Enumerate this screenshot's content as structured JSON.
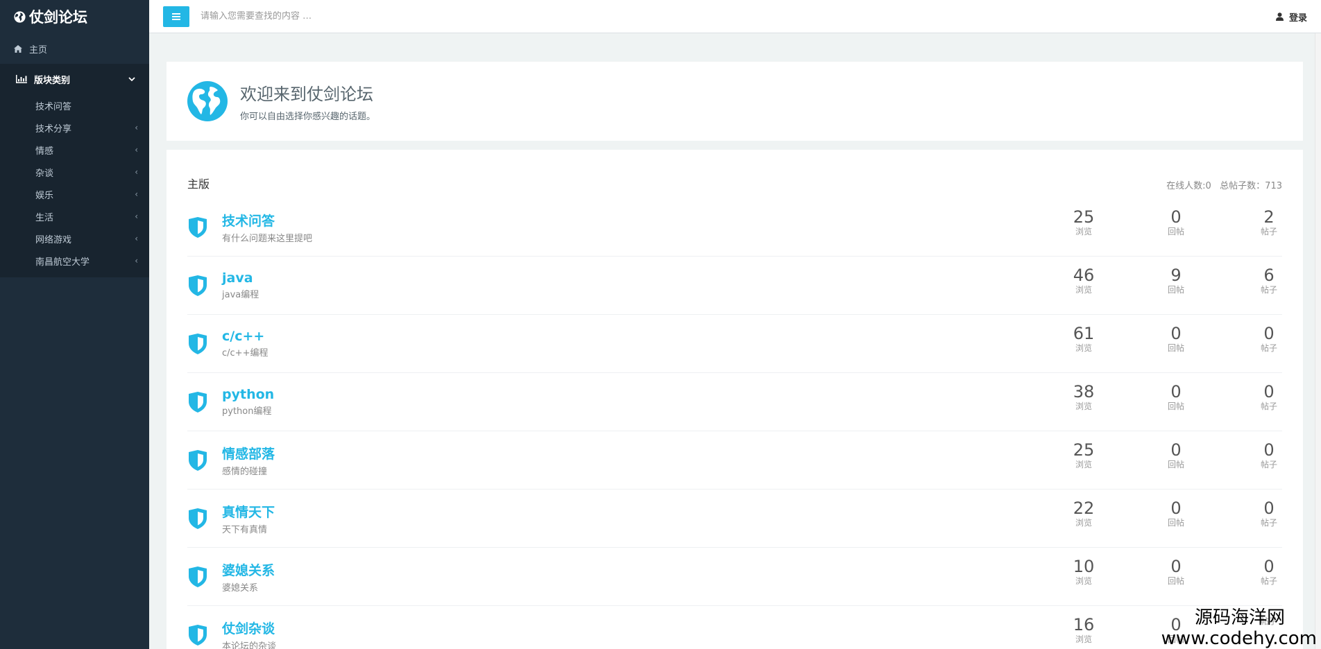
{
  "sidebar": {
    "brand": "仗剑论坛",
    "home": "主页",
    "group": {
      "label": "版块类别"
    },
    "items": [
      {
        "label": "技术问答",
        "chevron": ""
      },
      {
        "label": "技术分享",
        "chevron": "‹"
      },
      {
        "label": "情感",
        "chevron": "‹"
      },
      {
        "label": "杂谈",
        "chevron": "‹"
      },
      {
        "label": "娱乐",
        "chevron": "‹"
      },
      {
        "label": "生活",
        "chevron": "‹"
      },
      {
        "label": "网络游戏",
        "chevron": "‹"
      },
      {
        "label": "南昌航空大学",
        "chevron": "‹"
      }
    ]
  },
  "topbar": {
    "search_placeholder": "请输入您需要查找的内容 …",
    "login": "登录"
  },
  "welcome": {
    "title": "欢迎来到仗剑论坛",
    "subtitle": "你可以自由选择你感兴趣的话题。"
  },
  "board": {
    "title": "主版",
    "online": "在线人数:0",
    "total_posts": "总帖子数：713",
    "stat_labels": {
      "views": "浏览",
      "replies": "回帖",
      "posts": "帖子"
    },
    "forums": [
      {
        "name": "技术问答",
        "desc": "有什么问题来这里提吧",
        "views": "25",
        "replies": "0",
        "posts": "2"
      },
      {
        "name": "java",
        "desc": "java编程",
        "views": "46",
        "replies": "9",
        "posts": "6"
      },
      {
        "name": "c/c++",
        "desc": "c/c++编程",
        "views": "61",
        "replies": "0",
        "posts": "0"
      },
      {
        "name": "python",
        "desc": "python编程",
        "views": "38",
        "replies": "0",
        "posts": "0"
      },
      {
        "name": "情感部落",
        "desc": "感情的碰撞",
        "views": "25",
        "replies": "0",
        "posts": "0"
      },
      {
        "name": "真情天下",
        "desc": "天下有真情",
        "views": "22",
        "replies": "0",
        "posts": "0"
      },
      {
        "name": "婆媳关系",
        "desc": "婆媳关系",
        "views": "10",
        "replies": "0",
        "posts": "0"
      },
      {
        "name": "仗剑杂谈",
        "desc": "本论坛的杂谈",
        "views": "16",
        "replies": "0",
        "posts": ""
      }
    ]
  },
  "watermark": {
    "line1": "源码海洋网",
    "line2": "www.codehy.com"
  },
  "colors": {
    "accent": "#23b7e5",
    "sidebar_bg": "#1e2d3b",
    "page_bg": "#eff3f3"
  },
  "icons": {
    "brand": "globe-icon",
    "home": "home-icon",
    "group": "bar-chart-icon",
    "forum": "shield-icon",
    "login": "user-icon",
    "menu": "hamburger-icon"
  }
}
